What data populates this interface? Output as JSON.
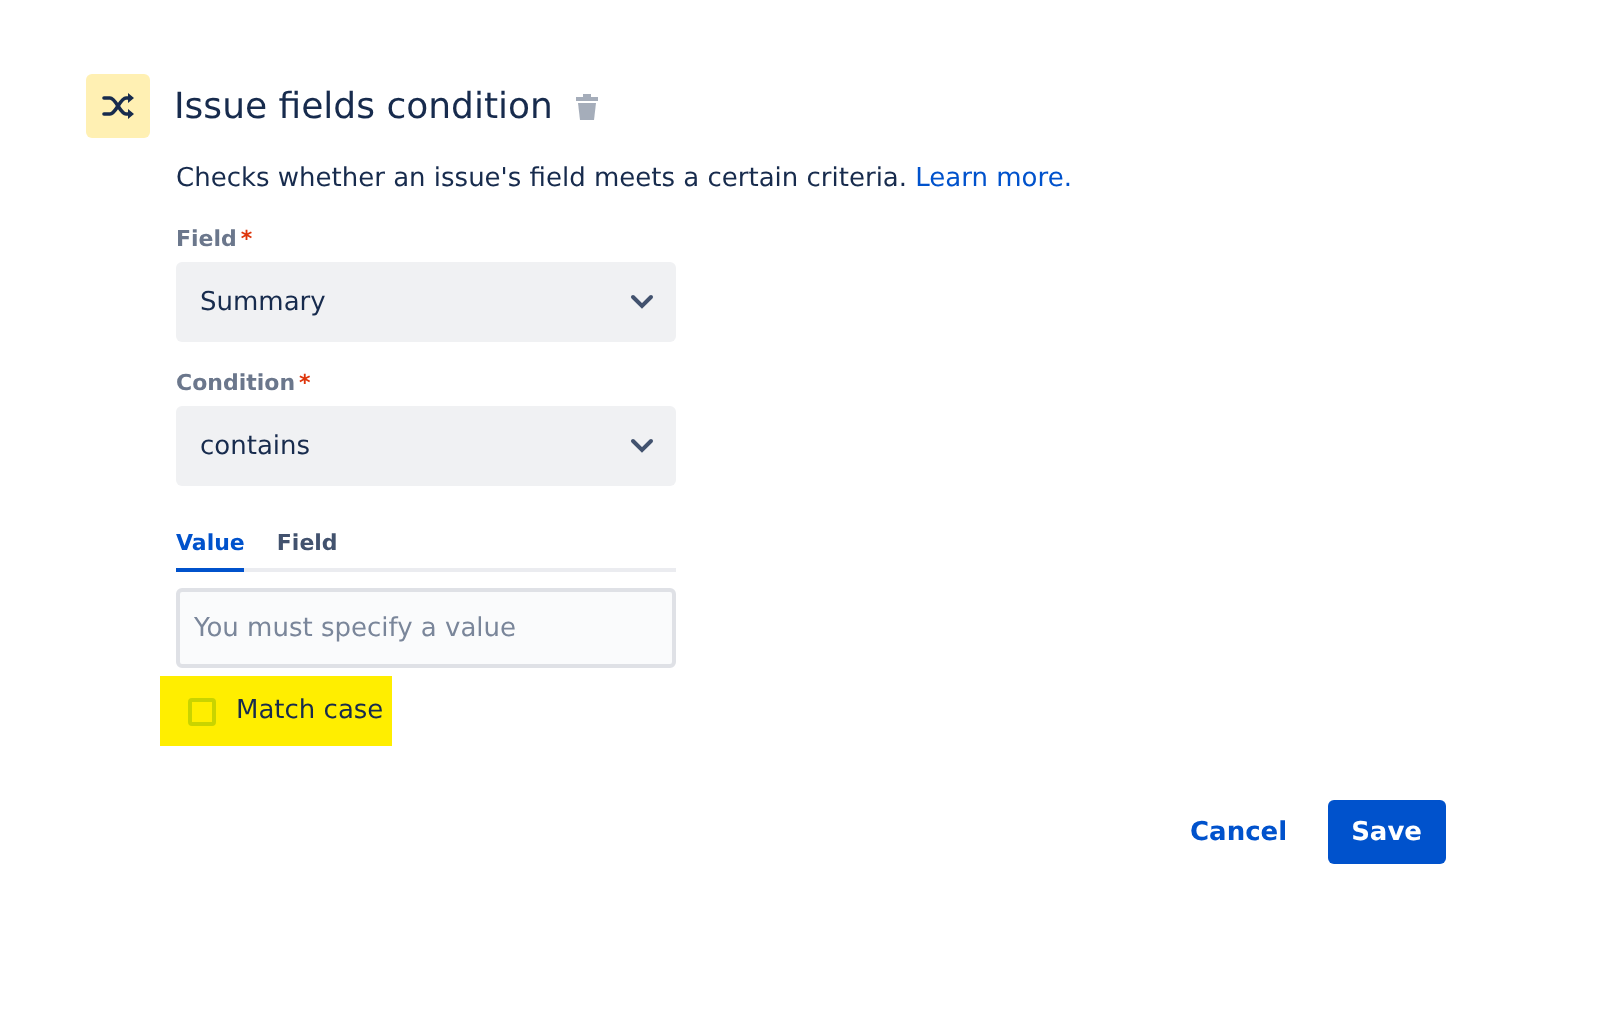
{
  "header": {
    "title": "Issue fields condition"
  },
  "description": {
    "text": "Checks whether an issue's field meets a certain criteria.",
    "link": "Learn more."
  },
  "fields": [
    {
      "label": "Field",
      "required_mark": "*",
      "value": "Summary"
    },
    {
      "label": "Condition",
      "required_mark": "*",
      "value": "contains"
    }
  ],
  "tabs": [
    {
      "label": "Value",
      "selected": true
    },
    {
      "label": "Field",
      "selected": false
    }
  ],
  "value_input": {
    "placeholder": "You must specify a value"
  },
  "match_case": {
    "label": "Match case",
    "checked": false,
    "highlighted": true
  },
  "buttons": [
    {
      "label": "Cancel",
      "kind": "subtle"
    },
    {
      "label": "Save",
      "kind": "primary"
    }
  ]
}
